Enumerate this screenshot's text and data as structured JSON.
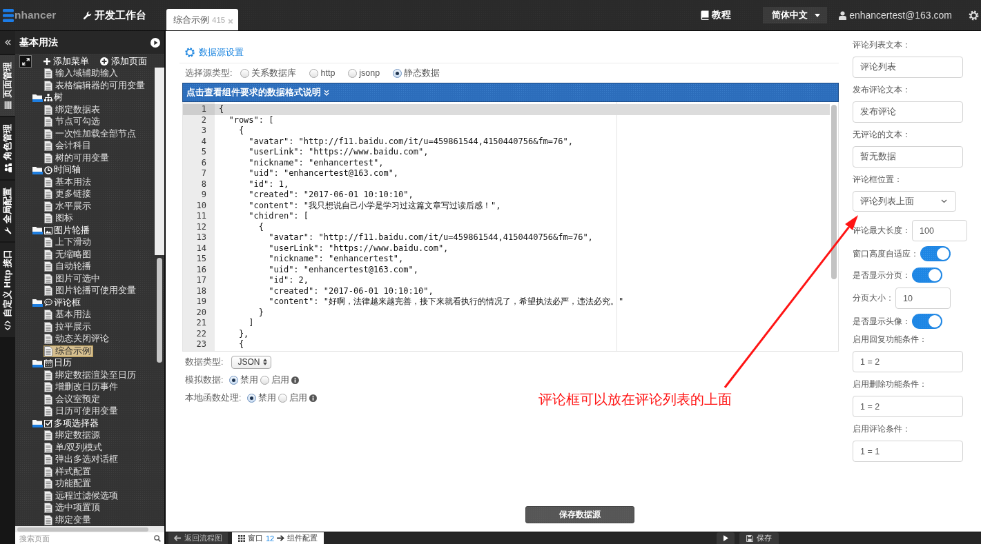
{
  "topbar": {
    "logo_text": "nhancer",
    "workbench": "开发工作台",
    "tabs": [
      {
        "label": "综合示例",
        "count": "415",
        "selected": true
      }
    ],
    "tutorial": "教程",
    "language": "简体中文",
    "user": "enhancertest@163.com"
  },
  "side_tabs": [
    {
      "label": "页面管理",
      "selected": true
    },
    {
      "label": "角色管理",
      "selected": false
    },
    {
      "label": "全局配置",
      "selected": false
    },
    {
      "label": "自定义 Http 接口",
      "selected": false
    }
  ],
  "sidebar": {
    "title": "基本用法",
    "actions": [
      "添加菜单",
      "添加页面"
    ],
    "tree": [
      {
        "children": [
          {
            "label": "输入域辅助输入",
            "selected": false
          },
          {
            "label": "表格编辑器的可用变量",
            "selected": false
          }
        ]
      },
      {
        "label": "树",
        "selected": false,
        "expanded": true,
        "children": [
          {
            "label": "绑定数据表",
            "selected": false
          },
          {
            "label": "节点可勾选",
            "selected": false
          },
          {
            "label": "一次性加载全部节点",
            "selected": false
          },
          {
            "label": "会计科目",
            "selected": false
          },
          {
            "label": "树的可用变量",
            "selected": false
          }
        ]
      },
      {
        "label": "时间轴",
        "selected": false,
        "expanded": true,
        "children": [
          {
            "label": "基本用法",
            "selected": false
          },
          {
            "label": "更多链接",
            "selected": false
          },
          {
            "label": "水平展示",
            "selected": false
          },
          {
            "label": "图标",
            "selected": false
          }
        ]
      },
      {
        "label": "图片轮播",
        "selected": false,
        "expanded": true,
        "children": [
          {
            "label": "上下滑动",
            "selected": false
          },
          {
            "label": "无缩略图",
            "selected": false
          },
          {
            "label": "自动轮播",
            "selected": false
          },
          {
            "label": "图片可选中",
            "selected": false
          },
          {
            "label": "图片轮播可使用变量",
            "selected": false
          }
        ]
      },
      {
        "label": "评论框",
        "selected": false,
        "expanded": true,
        "children": [
          {
            "label": "基本用法",
            "selected": false
          },
          {
            "label": "拉平展示",
            "selected": false
          },
          {
            "label": "动态关闭评论",
            "selected": false
          },
          {
            "label": "综合示例",
            "selected": true
          }
        ]
      },
      {
        "label": "日历",
        "selected": false,
        "expanded": true,
        "children": [
          {
            "label": "绑定数据渲染至日历",
            "selected": false
          },
          {
            "label": "增删改日历事件",
            "selected": false
          },
          {
            "label": "会议室预定",
            "selected": false
          },
          {
            "label": "日历可使用变量",
            "selected": false
          }
        ]
      },
      {
        "label": "多项选择器",
        "selected": false,
        "expanded": true,
        "children": [
          {
            "label": "绑定数据源",
            "selected": false
          },
          {
            "label": "单/双列模式",
            "selected": false
          },
          {
            "label": "弹出多选对话框",
            "selected": false
          },
          {
            "label": "样式配置",
            "selected": false
          },
          {
            "label": "功能配置",
            "selected": false
          },
          {
            "label": "远程过滤候选项",
            "selected": false
          },
          {
            "label": "选中项置顶",
            "selected": false
          },
          {
            "label": "绑定变量",
            "selected": false
          }
        ]
      }
    ],
    "search": {
      "placeholder": "搜索页面"
    }
  },
  "datasource": {
    "title": "数据源设置",
    "source_label": "选择源类型:",
    "source_types": [
      {
        "label": "关系数据库",
        "selected": false
      },
      {
        "label": "http",
        "selected": false
      },
      {
        "label": "jsonp",
        "selected": false
      },
      {
        "label": "静态数据",
        "selected": true
      }
    ],
    "format_help": "点击查看组件要求的数据格式说明",
    "editor": {
      "lines": [
        {
          "number": "1",
          "text": "{",
          "active": true
        },
        {
          "number": "2",
          "text": "  \"rows\": [",
          "active": false
        },
        {
          "number": "3",
          "text": "    {",
          "active": false
        },
        {
          "number": "4",
          "text": "      \"avatar\": \"http://f11.baidu.com/it/u=459861544,4150440756&fm=76\",",
          "active": false
        },
        {
          "number": "5",
          "text": "      \"userLink\": \"https://www.baidu.com\",",
          "active": false
        },
        {
          "number": "6",
          "text": "      \"nickname\": \"enhancertest\",",
          "active": false
        },
        {
          "number": "7",
          "text": "      \"uid\": \"enhancertest@163.com\",",
          "active": false
        },
        {
          "number": "8",
          "text": "      \"id\": 1,",
          "active": false
        },
        {
          "number": "9",
          "text": "      \"created\": \"2017-06-01 10:10:10\",",
          "active": false
        },
        {
          "number": "10",
          "text": "      \"content\": \"我只想说自己小学是学习过这篇文章写过读后感！\",",
          "active": false
        },
        {
          "number": "11",
          "text": "      \"chidren\": [",
          "active": false
        },
        {
          "number": "12",
          "text": "        {",
          "active": false
        },
        {
          "number": "13",
          "text": "          \"avatar\": \"http://f11.baidu.com/it/u=459861544,4150440756&fm=76\",",
          "active": false
        },
        {
          "number": "14",
          "text": "          \"userLink\": \"https://www.baidu.com\",",
          "active": false
        },
        {
          "number": "15",
          "text": "          \"nickname\": \"enhancertest\",",
          "active": false
        },
        {
          "number": "16",
          "text": "          \"uid\": \"enhancertest@163.com\",",
          "active": false
        },
        {
          "number": "17",
          "text": "          \"id\": 2,",
          "active": false
        },
        {
          "number": "18",
          "text": "          \"created\": \"2017-06-01 10:10:10\",",
          "active": false
        },
        {
          "number": "19",
          "text": "          \"content\": \"好啊，法律越来越完善，接下来就看执行的情况了，希望执法必严，违法必究。\"",
          "active": false
        },
        {
          "number": "20",
          "text": "        }",
          "active": false
        },
        {
          "number": "21",
          "text": "      ]",
          "active": false
        },
        {
          "number": "22",
          "text": "    },",
          "active": false
        },
        {
          "number": "23",
          "text": "    {",
          "active": false
        }
      ]
    },
    "data_type": {
      "label": "数据类型:",
      "value": "JSON"
    },
    "mock": {
      "label": "模拟数据:",
      "options": [
        {
          "label": "禁用",
          "selected": true
        },
        {
          "label": "启用",
          "selected": false
        }
      ]
    },
    "local_functions": {
      "label": "本地函数处理:",
      "options": [
        {
          "label": "禁用",
          "selected": true
        },
        {
          "label": "启用",
          "selected": false
        }
      ]
    },
    "save_button": "保存数据源"
  },
  "settings": {
    "fields": [
      {
        "kind": "text",
        "label": "评论列表文本：",
        "value": "评论列表"
      },
      {
        "kind": "text",
        "label": "发布评论文本：",
        "value": "发布评论"
      },
      {
        "kind": "text",
        "label": "无评论的文本：",
        "value": "暂无数据"
      },
      {
        "kind": "select",
        "label": "评论框位置：",
        "value": "评论列表上面"
      },
      {
        "kind": "inline",
        "label": "评论最大长度：",
        "value": "100"
      },
      {
        "kind": "toggle",
        "label": "窗口高度自适应：",
        "on": true
      },
      {
        "kind": "toggle",
        "label": "是否显示分页：",
        "on": true
      },
      {
        "kind": "inline",
        "label": "分页大小：",
        "value": "10"
      },
      {
        "kind": "toggle",
        "label": "是否显示头像：",
        "on": true
      },
      {
        "kind": "text",
        "label": "启用回复功能条件：",
        "value": "1 = 2"
      },
      {
        "kind": "text",
        "label": "启用删除功能条件：",
        "value": "1 = 2"
      },
      {
        "kind": "text",
        "label": "启用评论条件：",
        "value": "1 = 1"
      }
    ]
  },
  "annotation": {
    "text": "评论框可以放在评论列表的上面"
  },
  "bottom_bar": {
    "back": "返回流程图",
    "window": {
      "label": "窗口",
      "number": "12",
      "target": "组件配置"
    },
    "save": "保存"
  }
}
